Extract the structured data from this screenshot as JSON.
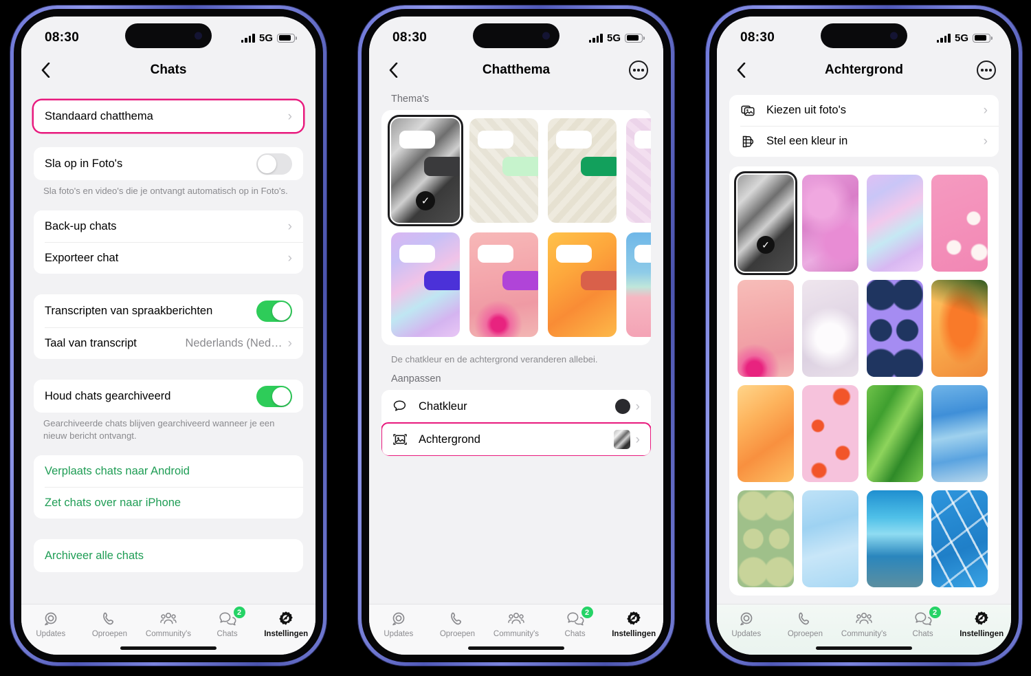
{
  "status_bar": {
    "time": "08:30",
    "network": "5G",
    "signal_icon": "cellular-bars-icon",
    "battery_icon": "battery-icon"
  },
  "tabbar": {
    "items": [
      {
        "label": "Updates",
        "icon": "updates-icon",
        "badge": "",
        "active": false
      },
      {
        "label": "Oproepen",
        "icon": "phone-icon",
        "badge": "",
        "active": false
      },
      {
        "label": "Community's",
        "icon": "communities-icon",
        "badge": "",
        "active": false
      },
      {
        "label": "Chats",
        "icon": "chats-icon",
        "badge": "2",
        "active": false
      },
      {
        "label": "Instellingen",
        "icon": "settings-gear-icon",
        "active": true
      }
    ]
  },
  "phone1": {
    "nav": {
      "title": "Chats",
      "back_icon": "chevron-left-icon"
    },
    "default_theme_row": {
      "label": "Standaard chatthema",
      "chevron": "›",
      "highlighted": true
    },
    "save_photos": {
      "label": "Sla op in Foto's",
      "toggle": "off"
    },
    "save_photos_note": "Sla foto's en video's die je ontvangt automatisch op in Foto's.",
    "backup_rows": [
      {
        "label": "Back-up chats",
        "chevron": "›"
      },
      {
        "label": "Exporteer chat",
        "chevron": "›"
      }
    ],
    "transcripts": {
      "label": "Transcripten van spraakberichten",
      "toggle": "on"
    },
    "transcript_lang": {
      "label": "Taal van transcript",
      "value": "Nederlands (Ned…",
      "chevron": "›"
    },
    "archive_toggle": {
      "label": "Houd chats gearchiveerd",
      "toggle": "on"
    },
    "archive_note": "Gearchiveerde chats blijven gearchiveerd wanneer je een nieuw bericht ontvangt.",
    "transfer_rows": [
      {
        "label": "Verplaats chats naar Android"
      },
      {
        "label": "Zet chats over naar iPhone"
      }
    ],
    "archive_all": {
      "label": "Archiveer alle chats"
    }
  },
  "phone2": {
    "nav": {
      "title": "Chatthema",
      "back_icon": "chevron-left-icon",
      "more_icon": "more-options-icon"
    },
    "themes_heading": "Thema's",
    "themes": [
      {
        "name": "dark-dune",
        "selected": true,
        "bubble": "#3a3a3c"
      },
      {
        "name": "doodle-cream",
        "selected": false,
        "bubble": "#c6f3cc"
      },
      {
        "name": "doodle-beige",
        "selected": false,
        "bubble": "#12a05c"
      },
      {
        "name": "doodle-pink",
        "selected": false,
        "bubble": "#4b31d8"
      },
      {
        "name": "holographic-lilac",
        "selected": false,
        "bubble": "#4b31d8"
      },
      {
        "name": "pink-floral",
        "selected": false,
        "bubble": "#b044d8"
      },
      {
        "name": "orange-silk",
        "selected": false,
        "bubble": "#d9604a"
      },
      {
        "name": "beach-pink",
        "selected": false,
        "bubble": "#0c7a63"
      }
    ],
    "themes_note": "De chatkleur en de achtergrond veranderen allebei.",
    "customize_heading": "Aanpassen",
    "customize_rows": [
      {
        "label": "Chatkleur",
        "icon": "chat-bubble-icon",
        "swatch": "color-dot",
        "chevron": "›",
        "highlighted": false
      },
      {
        "label": "Achtergrond",
        "icon": "wallpaper-icon",
        "swatch": "image-thumb",
        "chevron": "›",
        "highlighted": true
      }
    ]
  },
  "phone3": {
    "nav": {
      "title": "Achtergrond",
      "back_icon": "chevron-left-icon",
      "more_icon": "more-options-icon"
    },
    "source_rows": [
      {
        "label": "Kiezen uit foto's",
        "icon": "photos-stack-icon",
        "chevron": "›"
      },
      {
        "label": "Stel een kleur in",
        "icon": "color-palette-icon",
        "chevron": "›"
      }
    ],
    "wallpapers": [
      {
        "name": "dark-dune",
        "selected": true
      },
      {
        "name": "pink-peony"
      },
      {
        "name": "holographic-lilac"
      },
      {
        "name": "pink-palm-clouds"
      },
      {
        "name": "pink-dahlia"
      },
      {
        "name": "white-dandelion"
      },
      {
        "name": "purple-figs"
      },
      {
        "name": "orange-canna-lily"
      },
      {
        "name": "orange-silk"
      },
      {
        "name": "pink-crabs"
      },
      {
        "name": "green-aloe"
      },
      {
        "name": "blue-ink"
      },
      {
        "name": "green-olives"
      },
      {
        "name": "light-blue-silk"
      },
      {
        "name": "blue-waves"
      },
      {
        "name": "blue-lines"
      }
    ]
  },
  "colors": {
    "highlight": "#e8197d",
    "toggle_on": "#2ecc59",
    "badge": "#25d366",
    "green_link": "#1f9d55"
  }
}
